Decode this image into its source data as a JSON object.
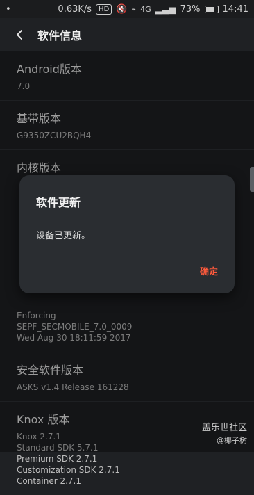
{
  "status_bar": {
    "speed": "0.63K/s",
    "hd": "HD",
    "network": "4G",
    "battery": "73%",
    "time": "14:41",
    "battery_level": 0.73
  },
  "header": {
    "title": "软件信息",
    "back_icon": "chevron-left-icon"
  },
  "items": [
    {
      "title": "Android版本",
      "lines": [
        "7.0"
      ]
    },
    {
      "title": "基带版本",
      "lines": [
        "G9350ZCU2BQH4"
      ]
    },
    {
      "title": "内核版本",
      "lines": []
    },
    {
      "title": "",
      "lines": []
    },
    {
      "title": "",
      "lines": [
        "Enforcing",
        "SEPF_SECMOBILE_7.0_0009",
        "Wed Aug 30 18:11:59 2017"
      ]
    },
    {
      "title": "安全软件版本",
      "lines": [
        "ASKS v1.4 Release 161228"
      ]
    },
    {
      "title": "Knox 版本",
      "lines": [
        "Knox 2.7.1",
        "Standard SDK 5.7.1",
        "Premium SDK 2.7.1",
        "Customization SDK 2.7.1",
        "Container 2.7.1"
      ]
    }
  ],
  "dialog": {
    "title": "软件更新",
    "message": "设备已更新。",
    "confirm_label": "确定"
  },
  "watermark": {
    "brand": "盖乐世社区",
    "user": "@椰子树"
  }
}
